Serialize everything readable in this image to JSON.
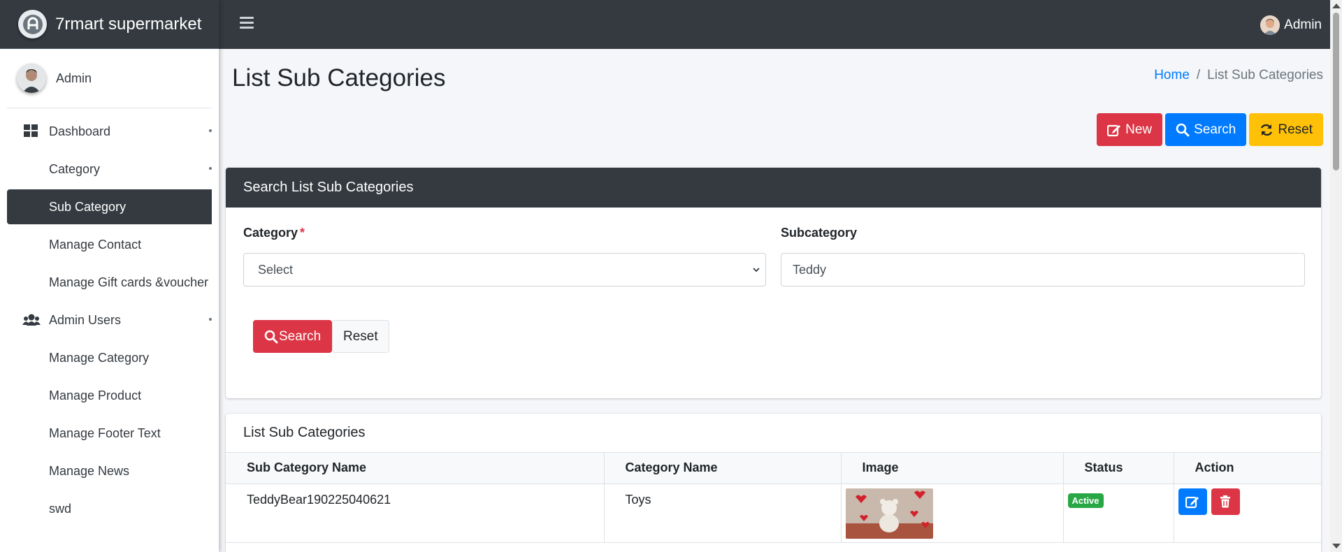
{
  "brand": {
    "name": "7rmart supermarket"
  },
  "sidebar": {
    "user_name": "Admin",
    "items": [
      {
        "label": "Dashboard",
        "icon": "grid-icon",
        "has_caret": true
      },
      {
        "label": "Category",
        "has_caret": true
      },
      {
        "label": "Sub Category",
        "active": true
      },
      {
        "label": "Manage Contact"
      },
      {
        "label": "Manage Gift cards &voucher"
      },
      {
        "label": "Admin Users",
        "icon": "users-icon",
        "has_caret": true
      },
      {
        "label": "Manage Category"
      },
      {
        "label": "Manage Product"
      },
      {
        "label": "Manage Footer Text"
      },
      {
        "label": "Manage News"
      },
      {
        "label": "swd"
      }
    ]
  },
  "navbar": {
    "user_name": "Admin"
  },
  "page": {
    "title": "List Sub Categories",
    "breadcrumb": {
      "home": "Home",
      "separator": "/",
      "current": "List Sub Categories"
    }
  },
  "toolbar": {
    "new_label": "New",
    "search_label": "Search",
    "reset_label": "Reset"
  },
  "search_card": {
    "title": "Search List Sub Categories",
    "category_label": "Category",
    "required_mark": "*",
    "category_value": "Select",
    "subcategory_label": "Subcategory",
    "subcategory_value": "Teddy",
    "search_button": "Search",
    "reset_button": "Reset"
  },
  "list_card": {
    "title": "List Sub Categories",
    "columns": [
      "Sub Category Name",
      "Category Name",
      "Image",
      "Status",
      "Action"
    ],
    "rows": [
      {
        "sub_category": "TeddyBear190225040621",
        "category": "Toys",
        "status": "Active"
      }
    ]
  },
  "colors": {
    "dark": "#343a40",
    "danger": "#dc3545",
    "primary": "#007bff",
    "warning": "#ffc107",
    "success": "#28a745"
  }
}
